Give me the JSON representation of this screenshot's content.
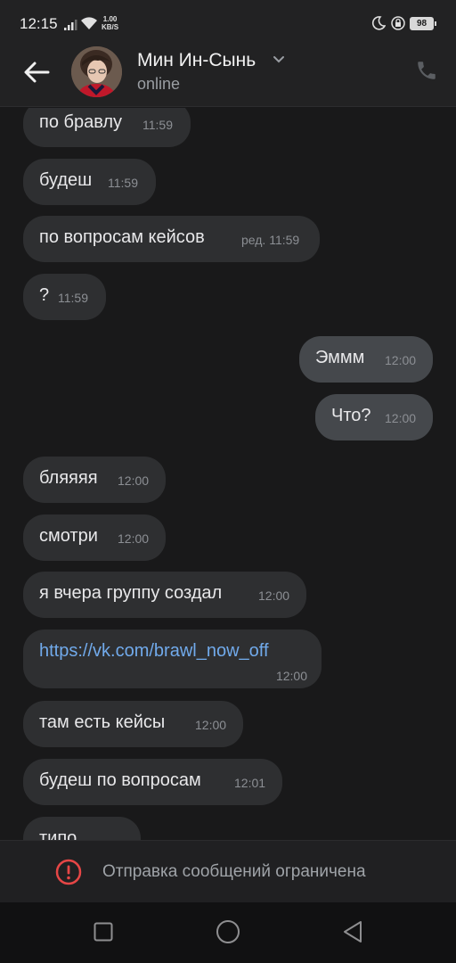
{
  "status_bar": {
    "time": "12:15",
    "net_speed_value": "1.00",
    "net_speed_unit": "KB/S",
    "battery": "98"
  },
  "header": {
    "contact_name": "Мин Ин-Сынь",
    "contact_status": "online"
  },
  "messages": [
    {
      "dir": "in",
      "text": "по бравлу",
      "time": "11:59"
    },
    {
      "dir": "in",
      "text": "будеш",
      "time": "11:59"
    },
    {
      "dir": "in",
      "text": "по вопросам кейсов",
      "edited": "ред.",
      "time": "11:59"
    },
    {
      "dir": "in",
      "text": "?",
      "time": "11:59"
    },
    {
      "dir": "out",
      "text": "Эммм",
      "time": "12:00"
    },
    {
      "dir": "out",
      "text": "Что?",
      "time": "12:00"
    },
    {
      "dir": "in",
      "text": "бляяяя",
      "time": "12:00"
    },
    {
      "dir": "in",
      "text": "смотри",
      "time": "12:00"
    },
    {
      "dir": "in",
      "text": "я вчера группу создал",
      "time": "12:00"
    },
    {
      "dir": "in",
      "text": "https://vk.com/brawl_now_off",
      "time": "12:00",
      "is_link": true
    },
    {
      "dir": "in",
      "text": "там есть кейсы",
      "time": "12:00"
    },
    {
      "dir": "in",
      "text": "будеш по вопросам",
      "time": "12:01"
    },
    {
      "dir": "in",
      "text": "типо",
      "time": ""
    }
  ],
  "composer": {
    "restriction_text": "Отправка сообщений ограничена"
  },
  "icons": {
    "back": "arrow-left-icon",
    "call": "phone-icon",
    "restriction": "exclamation-circle-icon",
    "nav_recents": "square-icon",
    "nav_home": "circle-icon",
    "nav_back": "triangle-icon"
  },
  "colors": {
    "background": "#19191a",
    "bubble_in": "#2e2f31",
    "bubble_out": "#45484c",
    "link": "#71aaeb",
    "alert": "#e64646"
  }
}
